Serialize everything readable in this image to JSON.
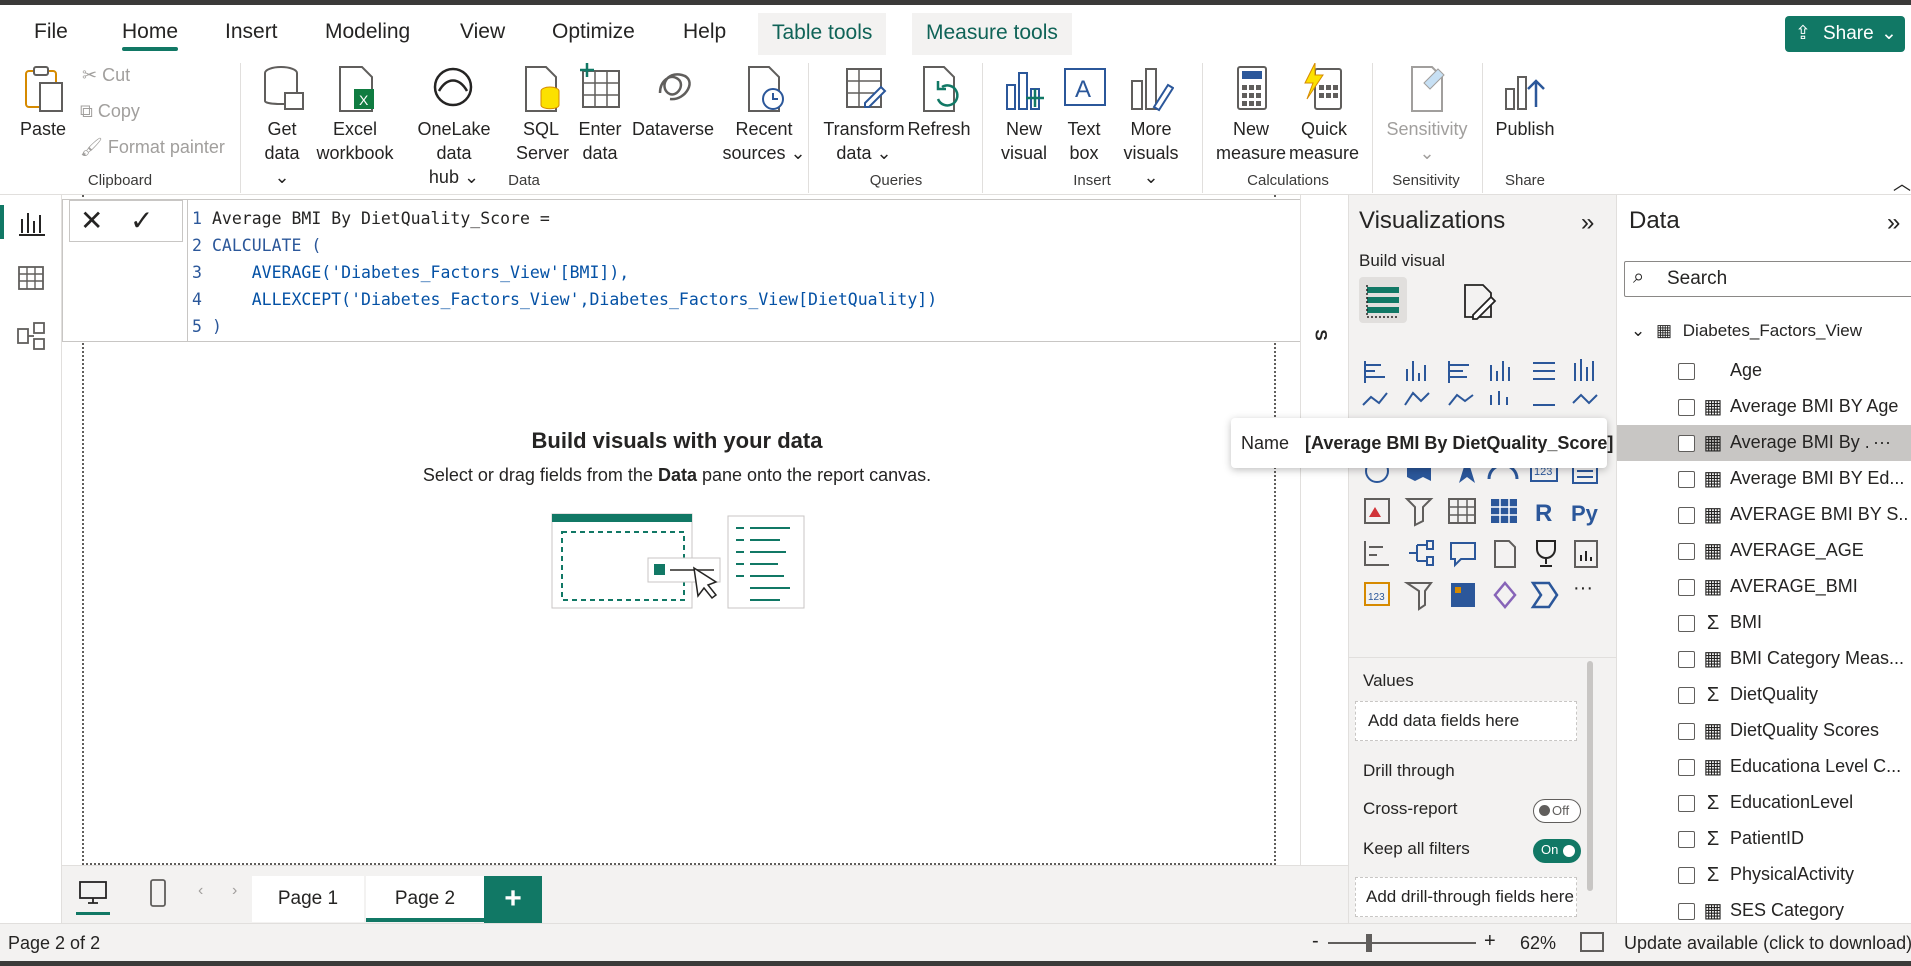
{
  "menu_tabs": [
    "File",
    "Home",
    "Insert",
    "Modeling",
    "View",
    "Optimize",
    "Help",
    "Table tools",
    "Measure tools"
  ],
  "share_label": "Share",
  "ribbon": {
    "clipboard": {
      "paste": "Paste",
      "cut": "Cut",
      "copy": "Copy",
      "format_painter": "Format painter",
      "group": "Clipboard"
    },
    "data": {
      "get_data": [
        "Get",
        "data"
      ],
      "excel": [
        "Excel",
        "workbook"
      ],
      "onelake": [
        "OneLake data",
        "hub"
      ],
      "sql": [
        "SQL",
        "Server"
      ],
      "enter": [
        "Enter",
        "data"
      ],
      "dataverse": "Dataverse",
      "recent": [
        "Recent",
        "sources"
      ],
      "group": "Data"
    },
    "queries": {
      "transform": [
        "Transform",
        "data"
      ],
      "refresh": "Refresh",
      "group": "Queries"
    },
    "insert": {
      "new_visual": [
        "New",
        "visual"
      ],
      "text_box": [
        "Text",
        "box"
      ],
      "more_visuals": [
        "More",
        "visuals"
      ],
      "group": "Insert"
    },
    "calculations": {
      "new_measure": [
        "New",
        "measure"
      ],
      "quick_measure": [
        "Quick",
        "measure"
      ],
      "group": "Calculations"
    },
    "sensitivity": {
      "label": "Sensitivity",
      "group": "Sensitivity"
    },
    "share": {
      "publish": "Publish",
      "group": "Share"
    }
  },
  "formula": {
    "lines": [
      {
        "n": "1",
        "text": "Average BMI By DietQuality_Score ="
      },
      {
        "n": "2",
        "text": "CALCULATE ("
      },
      {
        "n": "3",
        "text": "    AVERAGE('Diabetes_Factors_View'[BMI]),"
      },
      {
        "n": "4",
        "text": "    ALLEXCEPT('Diabetes_Factors_View',Diabetes_Factors_View[DietQuality])"
      },
      {
        "n": "5",
        "text": ")"
      }
    ]
  },
  "canvas": {
    "title": "Build visuals with your data",
    "sub_pre": "Select or drag fields from the ",
    "sub_bold": "Data",
    "sub_post": " pane onto the report canvas."
  },
  "pages": {
    "page1": "Page 1",
    "page2": "Page 2"
  },
  "status": {
    "page_info": "Page 2 of 2",
    "zoom": "62%",
    "update": "Update available (click to download)"
  },
  "viz": {
    "title": "Visualizations",
    "build": "Build visual",
    "values": "Values",
    "values_well": "Add data fields here",
    "drill": "Drill through",
    "cross_report": "Cross-report",
    "cross_state": "Off",
    "keep_filters": "Keep all filters",
    "keep_state": "On",
    "drill_well": "Add drill-through fields here",
    "ellipsis": "···"
  },
  "data_pane": {
    "title": "Data",
    "search_placeholder": "Search",
    "table": "Diabetes_Factors_View",
    "fields": [
      {
        "label": "Age",
        "icon": "none"
      },
      {
        "label": "Average BMI BY Age",
        "icon": "calc"
      },
      {
        "label": "Average BMI By ...",
        "icon": "calc"
      },
      {
        "label": "Average BMI BY Ed...",
        "icon": "calc"
      },
      {
        "label": "AVERAGE BMI BY S...",
        "icon": "calc"
      },
      {
        "label": "AVERAGE_AGE",
        "icon": "calc"
      },
      {
        "label": "AVERAGE_BMI",
        "icon": "calc"
      },
      {
        "label": "BMI",
        "icon": "sigma"
      },
      {
        "label": "BMI Category Meas...",
        "icon": "calc"
      },
      {
        "label": "DietQuality",
        "icon": "sigma"
      },
      {
        "label": "DietQuality Scores",
        "icon": "calc"
      },
      {
        "label": "Educationa Level C...",
        "icon": "calc"
      },
      {
        "label": "EducationLevel",
        "icon": "sigma"
      },
      {
        "label": "PatientID",
        "icon": "sigma"
      },
      {
        "label": "PhysicalActivity",
        "icon": "sigma"
      },
      {
        "label": "SES Category",
        "icon": "calc"
      }
    ],
    "more": "···"
  },
  "tooltip": {
    "key": "Name",
    "value": "[Average BMI By DietQuality_Score]"
  },
  "side_label": "S",
  "colors": {
    "accent": "#117865",
    "code_blue": "#2b579a"
  }
}
